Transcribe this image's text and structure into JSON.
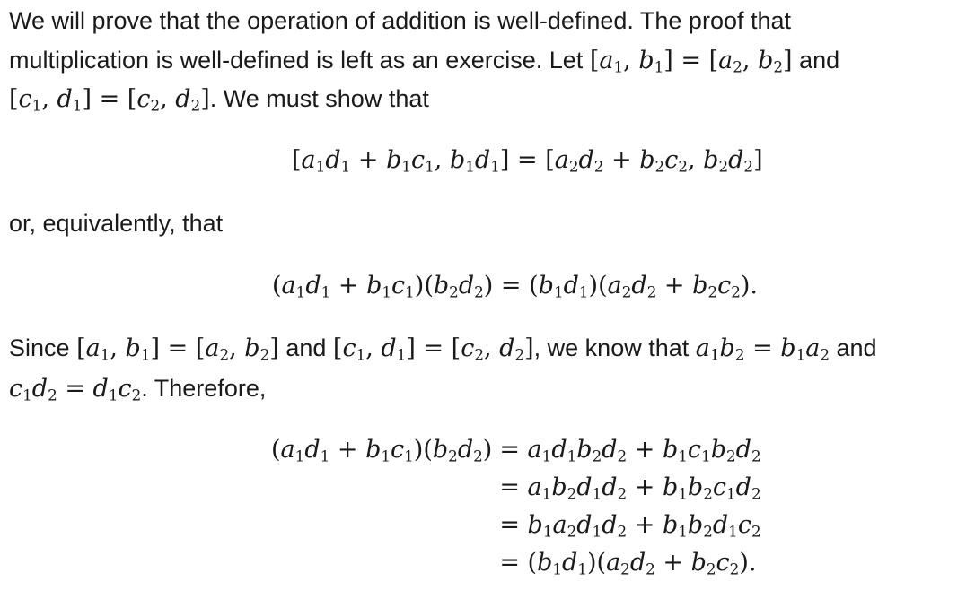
{
  "paragraph1": {
    "line1": "We will prove that the operation of addition is well-defined. The proof that",
    "line2_text": "multiplication is well-defined is left as an exercise. Let",
    "line2_and": "and",
    "line3_end": ". We must show that"
  },
  "paragraph2": {
    "text": "or, equivalently, that"
  },
  "paragraph3": {
    "since": "Since",
    "and1": "and",
    "know": ", we know that",
    "and2": "and",
    "therefore": ". Therefore,"
  },
  "math": {
    "eq_a": "[a₁, b₁] = [a₂, b₂]",
    "eq_c": "[c₁, d₁] = [c₂, d₂]",
    "display1": "[a₁d₁ + b₁c₁, b₁d₁] = [a₂d₂ + b₂c₂, b₂d₂]",
    "display2": "(a₁d₁ + b₁c₁)(b₂d₂) = (b₁d₁)(a₂d₂ + b₂c₂).",
    "ab_rel": "a₁b₂ = b₁a₂",
    "cd_rel": "c₁d₂ = d₁c₂",
    "align_lhs": "(a₁d₁ + b₁c₁)(b₂d₂)",
    "align_rows": [
      "= a₁d₁b₂d₂ + b₁c₁b₂d₂",
      "= a₁b₂d₁d₂ + b₁b₂c₁d₂",
      "= b₁a₂d₁d₂ + b₁b₂d₁c₂",
      "= (b₁d₁)(a₂d₂ + b₂c₂)."
    ]
  }
}
